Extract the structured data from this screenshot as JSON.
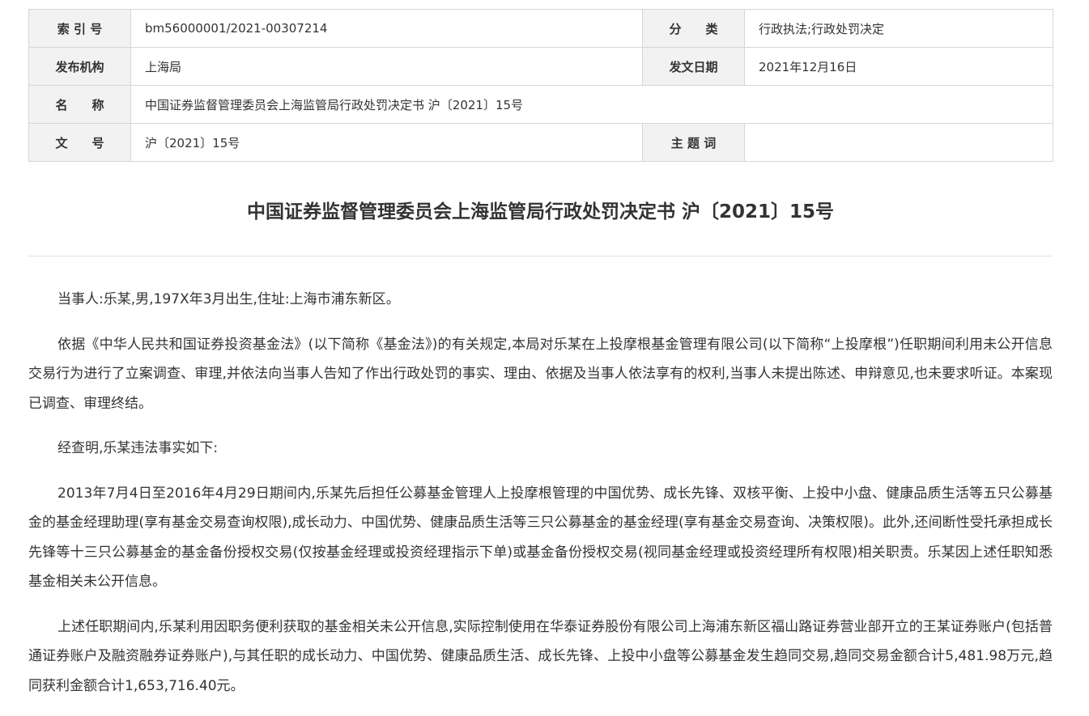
{
  "meta": {
    "index_label": "索 引 号",
    "index_value": "bm56000001/2021-00307214",
    "category_label": "分　　类",
    "category_value": "行政执法;行政处罚决定",
    "publisher_label": "发布机构",
    "publisher_value": "上海局",
    "date_label": "发文日期",
    "date_value": "2021年12月16日",
    "name_label": "名　　称",
    "name_value": "中国证券监督管理委员会上海监管局行政处罚决定书 沪〔2021〕15号",
    "docno_label": "文　　号",
    "docno_value": "沪〔2021〕15号",
    "keywords_label": "主 题 词",
    "keywords_value": ""
  },
  "document": {
    "title": "中国证券监督管理委员会上海监管局行政处罚决定书 沪〔2021〕15号",
    "paragraphs": [
      "当事人:乐某,男,197X年3月出生,住址:上海市浦东新区。",
      "依据《中华人民共和国证券投资基金法》(以下简称《基金法》)的有关规定,本局对乐某在上投摩根基金管理有限公司(以下简称“上投摩根”)任职期间利用未公开信息交易行为进行了立案调查、审理,并依法向当事人告知了作出行政处罚的事实、理由、依据及当事人依法享有的权利,当事人未提出陈述、申辩意见,也未要求听证。本案现已调查、审理终结。",
      "经查明,乐某违法事实如下:",
      "2013年7月4日至2016年4月29日期间内,乐某先后担任公募基金管理人上投摩根管理的中国优势、成长先锋、双核平衡、上投中小盘、健康品质生活等五只公募基金的基金经理助理(享有基金交易查询权限),成长动力、中国优势、健康品质生活等三只公募基金的基金经理(享有基金交易查询、决策权限)。此外,还间断性受托承担成长先锋等十三只公募基金的基金备份授权交易(仅按基金经理或投资经理指示下单)或基金备份授权交易(视同基金经理或投资经理所有权限)相关职责。乐某因上述任职知悉基金相关未公开信息。",
      "上述任职期间内,乐某利用因职务便利获取的基金相关未公开信息,实际控制使用在华泰证券股份有限公司上海浦东新区福山路证券营业部开立的王某证券账户(包括普通证券账户及融资融券证券账户),与其任职的成长动力、中国优势、健康品质生活、成长先锋、上投中小盘等公募基金发生趋同交易,趋同交易金额合计5,481.98万元,趋同获利金额合计1,653,716.40元。"
    ]
  }
}
